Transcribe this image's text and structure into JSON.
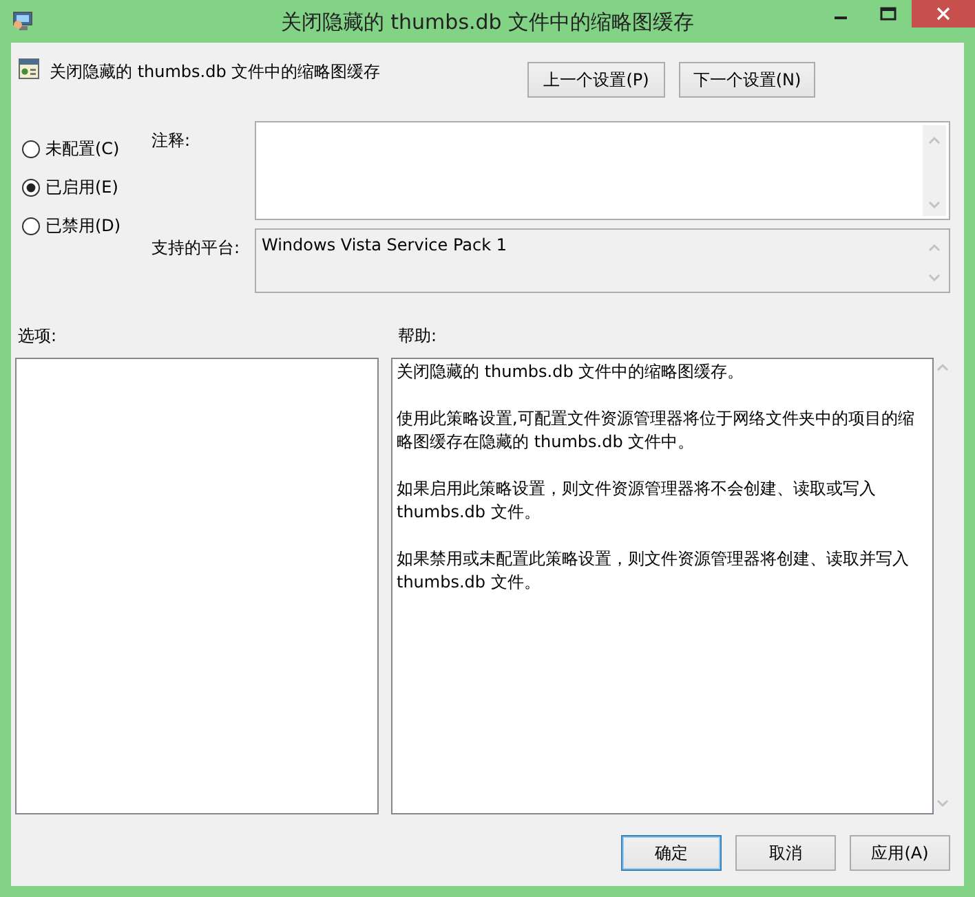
{
  "window": {
    "title": "关闭隐藏的 thumbs.db 文件中的缩略图缓存"
  },
  "header": {
    "title": "关闭隐藏的 thumbs.db 文件中的缩略图缓存"
  },
  "nav_buttons": [
    "上一个设置(P)",
    "下一个设置(N)"
  ],
  "state_options": [
    {
      "label": "未配置(C)",
      "selected": false
    },
    {
      "label": "已启用(E)",
      "selected": true
    },
    {
      "label": "已禁用(D)",
      "selected": false
    }
  ],
  "comment": {
    "label": "注释:"
  },
  "platform": {
    "label": "支持的平台:",
    "value": "Windows Vista Service Pack 1"
  },
  "options": {
    "label": "选项:"
  },
  "help": {
    "label": "帮助:",
    "paragraphs": [
      "关闭隐藏的 thumbs.db 文件中的缩略图缓存。",
      "使用此策略设置,可配置文件资源管理器将位于网络文件夹中的项目的缩略图缓存在隐藏的 thumbs.db 文件中。",
      "如果启用此策略设置，则文件资源管理器将不会创建、读取或写入 thumbs.db 文件。",
      "如果禁用或未配置此策略设置，则文件资源管理器将创建、读取并写入 thumbs.db 文件。"
    ]
  },
  "buttons": [
    {
      "label": "确定",
      "default": true
    },
    {
      "label": "取消",
      "default": false
    },
    {
      "label": "应用(A)",
      "default": false
    }
  ]
}
